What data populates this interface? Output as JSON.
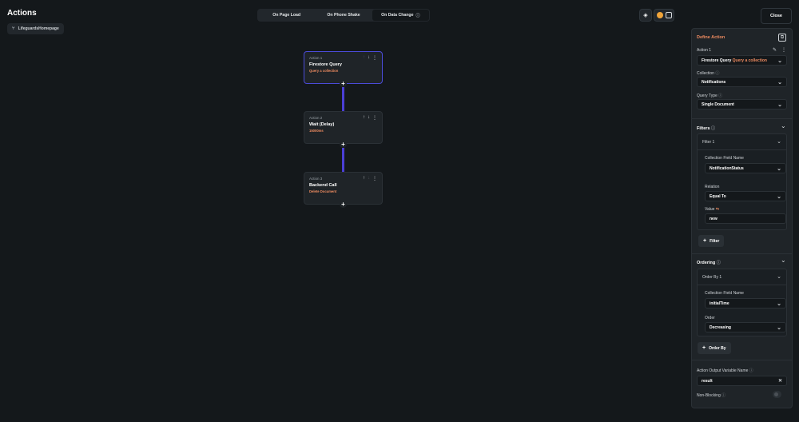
{
  "header": {
    "title": "Actions",
    "breadcrumb": "LifeguardsHomepage",
    "tabs": [
      {
        "label": "On Page Load",
        "active": false
      },
      {
        "label": "On Phone Shake",
        "active": false
      },
      {
        "label": "On Data Change",
        "active": true
      }
    ],
    "close_label": "Close"
  },
  "actions": [
    {
      "label": "Action 1",
      "name": "Firestore Query",
      "subtitle": "Query a collection",
      "selected": true
    },
    {
      "label": "Action 2",
      "name": "Wait (Delay)",
      "subtitle": "15000ms",
      "selected": false
    },
    {
      "label": "Action 3",
      "name": "Backend Call",
      "subtitle": "Delete Document",
      "selected": false
    }
  ],
  "panel": {
    "title": "Define Action",
    "action_label": "Action 1",
    "action_type": "Firestore Query",
    "action_type_sub": "Query a collection",
    "collection_label": "Collection",
    "collection_value": "Notifications",
    "query_type_label": "Query Type",
    "query_type_value": "Single Document",
    "filters_title": "Filters",
    "filter": {
      "header": "Filter 1",
      "field_label": "Collection Field Name",
      "field_value": "NotificationStatus",
      "relation_label": "Relation",
      "relation_value": "Equal To",
      "value_label": "Value",
      "value": "new"
    },
    "add_filter_label": "Filter",
    "ordering_title": "Ordering",
    "order": {
      "header": "Order By 1",
      "field_label": "Collection Field Name",
      "field_value": "initialTime",
      "order_label": "Order",
      "order_value": "Decreasing"
    },
    "add_order_label": "Order By",
    "output_label": "Action Output Variable Name",
    "output_value": "result",
    "non_blocking_label": "Non-Blocking",
    "non_blocking_on": false
  },
  "colors": {
    "accent": "#ee8b60",
    "connector": "#4b3fd6",
    "selected_border": "#4b4bd8"
  }
}
